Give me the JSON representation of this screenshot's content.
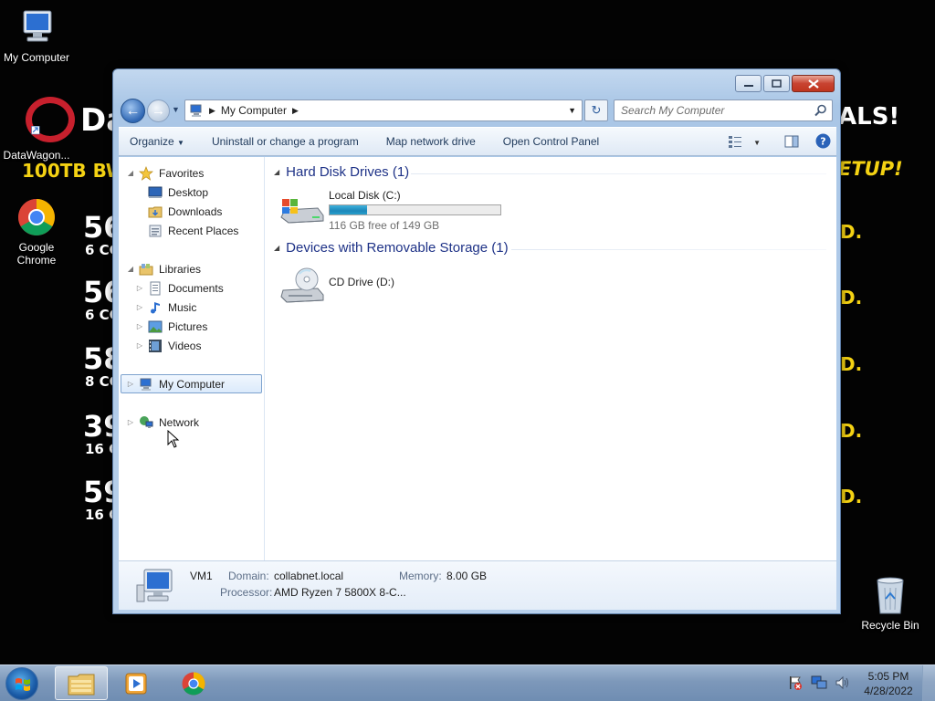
{
  "desktop": {
    "icons": [
      {
        "label": "My Computer",
        "icon": "my-computer-icon"
      },
      {
        "label": "DataWagon...",
        "icon": "datawagon-shortcut-icon"
      },
      {
        "label": "Google Chrome",
        "icon": "chrome-icon"
      },
      {
        "label": "Recycle Bin",
        "icon": "recycle-bin-icon"
      }
    ],
    "wallpaper": {
      "brand_text": "Da",
      "headline": "100TB BW",
      "right_top": "ALS!",
      "right_sub": "ETUP!",
      "rows": [
        {
          "num": "56",
          "sub": "6 CC"
        },
        {
          "num": "56",
          "sub": "6 CC"
        },
        {
          "num": "58",
          "sub": "8 CC"
        },
        {
          "num": "39",
          "sub": "16 C"
        },
        {
          "num": "59",
          "sub": "16 C"
        }
      ],
      "dot_char": "D.",
      "colors": {
        "brand_red": "#c7202d",
        "accent_yellow": "#f4d213"
      }
    }
  },
  "window": {
    "address": {
      "segment": "My Computer"
    },
    "search": {
      "placeholder": "Search My Computer"
    },
    "toolbar": {
      "organize": "Organize",
      "uninstall": "Uninstall or change a program",
      "map_drive": "Map network drive",
      "control_panel": "Open Control Panel"
    },
    "nav": {
      "favorites": "Favorites",
      "desktop": "Desktop",
      "downloads": "Downloads",
      "recent_places": "Recent Places",
      "libraries": "Libraries",
      "documents": "Documents",
      "music": "Music",
      "pictures": "Pictures",
      "videos": "Videos",
      "my_computer": "My Computer",
      "network": "Network"
    },
    "groups": {
      "hard_disks": "Hard Disk Drives (1)",
      "removable": "Devices with Removable Storage (1)"
    },
    "drives": {
      "local_disk": {
        "name": "Local Disk (C:)",
        "free_text": "116 GB free of 149 GB",
        "used_fraction": 0.22
      },
      "cd_drive": {
        "name": "CD Drive (D:)"
      }
    },
    "details": {
      "name": "VM1",
      "domain_label": "Domain:",
      "domain_value": "collabnet.local",
      "memory_label": "Memory:",
      "memory_value": "8.00 GB",
      "processor_label": "Processor:",
      "processor_value": "AMD Ryzen 7 5800X 8-C..."
    }
  },
  "taskbar": {
    "apps": [
      "windows-explorer-icon",
      "media-player-icon",
      "chrome-icon"
    ],
    "clock": {
      "time": "5:05 PM",
      "date": "4/28/2022"
    }
  }
}
